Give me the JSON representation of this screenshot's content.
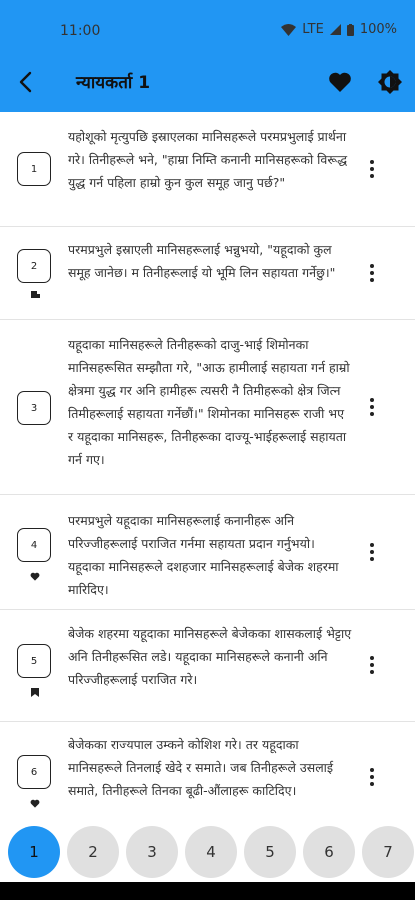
{
  "status": {
    "time": "11:00",
    "network": "LTE",
    "battery": "100%"
  },
  "toolbar": {
    "title": "न्यायकर्ता 1"
  },
  "verses": [
    {
      "number": "1",
      "text": "यहोशूको मृत्युपछि इस्राएलका मानिसहरूले परमप्रभुलाई प्रार्थना गरे। तिनीहरूले भने, \"हाम्रा निम्ति कनानी मानिसहरूको विरूद्ध युद्ध गर्न पहिला हाम्रो कुन कुल समूह जानु पर्छ?\"",
      "mark": ""
    },
    {
      "number": "2",
      "text": "परमप्रभुले इस्राएली मानिसहरूलाई भन्नुभयो, \"यहूदाको कुल समूह जानेछ। म तिनीहरूलाई यो भूमि लिन सहायता गर्नेछु।\"",
      "mark": "note"
    },
    {
      "number": "3",
      "text": "यहूदाका मानिसहरूले तिनीहरूको दाजु-भाई शिमोनका मानिसहरूसित सम्झौता गरे, \"आऊ हामीलाई सहायता गर्न हाम्रो क्षेत्रमा युद्ध गर अनि हामीहरू त्यसरी नै तिमीहरूको क्षेत्र जित्न तिमीहरूलाई सहायता गर्नेछौं।\" शिमोनका मानिसहरू राजी भए र यहूदाका मानिसहरू, तिनीहरूका दाज्यू-भाईहरूलाई सहायता गर्न गए।",
      "mark": ""
    },
    {
      "number": "4",
      "text": "परमप्रभुले यहूदाका मानिसहरूलाई कनानीहरू अनि परिज्जीहरूलाई पराजित गर्नमा सहायता प्रदान गर्नुभयो। यहूदाका मानिसहरूले दशहजार मानिसहरूलाई बेजेक शहरमा मारिदिए।",
      "mark": "heart"
    },
    {
      "number": "5",
      "text": "बेजेक शहरमा यहूदाका मानिसहरूले बेजेकका शासकलाई भेट्टाए अनि तिनीहरूसित लडे। यहूदाका मानिसहरूले कनानी अनि परिज्जीहरूलाई पराजित गरे।",
      "mark": "bookmark"
    },
    {
      "number": "6",
      "text": "बेजेकका राज्यपाल उम्कने कोशिश गरे। तर यहूदाका मानिसहरूले तिनलाई खेदे र समाते। जब तिनीहरूले उसलाई समाते, तिनीहरूले तिनका बूढी-औंलाहरू काटिदिए।",
      "mark": "heart"
    }
  ],
  "pager": [
    "1",
    "2",
    "3",
    "4",
    "5",
    "6",
    "7"
  ],
  "active_page": "1",
  "colors": {
    "accent": "#2196f3",
    "chip": "#e0e0e0"
  }
}
